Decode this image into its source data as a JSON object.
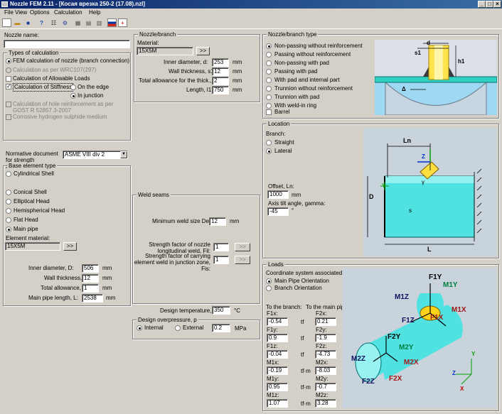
{
  "window": {
    "title": "Nozzle FEM 2.11 - [Косая врезка 250-2 (17.08).nzl]"
  },
  "menu": [
    "File",
    "View",
    "Options",
    "Calculation",
    "Help"
  ],
  "nozzle_name": {
    "label": "Nozzle name:",
    "value": ""
  },
  "calc_types": {
    "legend": "Types of calculation",
    "fem": "FEM calculation of nozzle (branch connection)",
    "wrc": "Calculation as per WRC107(297)",
    "allow": "Calculation of Allowable Loads",
    "stiff": "Calculation of Stiffness",
    "edge": "On the edge",
    "junction": "In junction",
    "hole": "Calculation of hole reinforcement as per GOST R 52857.3-2007",
    "corr": "Corrosive hydrogen sulphide medium"
  },
  "normative": {
    "label": "Normative document for strength estimation:",
    "value": "ASME VIII div 2"
  },
  "base": {
    "legend": "Base element type",
    "cyl": "Cylindrical Shell",
    "con": "Conical Shell",
    "ell": "Elliptical Head",
    "hem": "Hemispherical Head",
    "flat": "Flat Head",
    "main": "Main pipe",
    "mat_label": "Element material:",
    "mat": "15X5M",
    "btn": ">>",
    "D_label": "Inner diameter, D:",
    "D": "506",
    "s_label": "Wall thickness, s:",
    "s": "12",
    "c_label": "Total allowance, c:",
    "c": "1",
    "L_label": "Main pipe length, L:",
    "L": "2538",
    "mm": "mm"
  },
  "branch": {
    "legend": "Nozzle/branch",
    "mat_label": "Material:",
    "mat": "15X5M",
    "btn": ">>",
    "d_label": "Inner diameter, d:",
    "d": "253",
    "s1_label": "Wall thickness, s1:",
    "s1": "12",
    "cs_label": "Total allowance for the thick., cs:",
    "cs": "2",
    "l1_label": "Length, l1:",
    "l1": "750",
    "mm": "mm"
  },
  "weld": {
    "legend": "Weld seams",
    "delta_label": "Minimum weld size Delta:",
    "delta": "12",
    "mm": "mm",
    "fil_label": "Strength factor of nozzle longitudinal weld, Fil:",
    "fil": "1",
    "fis_label": "Strength factor of carrying element weld in junction zone, Fis:",
    "fis": "1",
    "btn": ">>"
  },
  "temp": {
    "label": "Design temperature, T:",
    "value": "350",
    "unit": "°C"
  },
  "pressure": {
    "legend": "Design overpressure, p",
    "internal": "Internal",
    "external": "External",
    "value": "0.2",
    "unit": "MPa"
  },
  "nozzle_type": {
    "legend": "Nozzle/branch type",
    "items": [
      "Non-passing without reinforcement",
      "Passing without reinforcement",
      "Non-passing with pad",
      "Passing with pad",
      "With pad and internal part",
      "Trunnion without reinforcement",
      "Trunnion with pad",
      "With weld-in ring"
    ],
    "barrel": "Barrel",
    "diagram_labels": {
      "d": "d",
      "s1": "s1",
      "h1": "h1",
      "delta": "Δ"
    }
  },
  "location": {
    "legend": "Location",
    "branch_label": "Branch:",
    "straight": "Straight",
    "lateral": "Lateral",
    "offset_label": "Offset, Ln:",
    "offset": "1000",
    "offset_unit": "mm",
    "tilt_label": "Axis tilt angle, gamma:",
    "tilt": "-45",
    "tilt_unit": "°",
    "diagram_labels": {
      "Ln": "Ln",
      "D": "D",
      "L": "L",
      "z": "Z",
      "y": "Y",
      "gamma": "γ",
      "s": "s"
    }
  },
  "loads": {
    "legend": "Loads",
    "cs_label": "Coordinate system associated with:",
    "main": "Main Pipe Orientation",
    "branch": "Branch Orientation",
    "col1": "To the branch:",
    "col2": "To the main pipe:",
    "rows": [
      {
        "n1": "F1x:",
        "v1": "-0.54",
        "u": "tf",
        "n2": "F2x:",
        "v2": "0.21"
      },
      {
        "n1": "F1y:",
        "v1": "0.9",
        "u": "tf",
        "n2": "F2y:",
        "v2": "-1.9"
      },
      {
        "n1": "F1z:",
        "v1": "-0.04",
        "u": "tf",
        "n2": "F2z:",
        "v2": "-4.73"
      },
      {
        "n1": "M1x:",
        "v1": "-0.19",
        "u": "tf·m",
        "n2": "M2x:",
        "v2": "-8.03"
      },
      {
        "n1": "M1y:",
        "v1": "0.95",
        "u": "tf·m",
        "n2": "M2y:",
        "v2": "-0.7"
      },
      {
        "n1": "M1z:",
        "v1": "1.07",
        "u": "tf·m",
        "n2": "M2z:",
        "v2": "3.28"
      }
    ],
    "diagram_labels": {
      "f1y": "F1Y",
      "m1y": "M1Y",
      "m1z": "M1Z",
      "m1x": "M1X",
      "f1z": "F1Z",
      "f1x": "F1X",
      "f2y": "F2Y",
      "m2y": "M2Y",
      "m2z": "M2Z",
      "f2z": "F2Z",
      "f2x": "F2X",
      "m2x": "M2X",
      "axz": "Z",
      "axx": "X",
      "axy": "Y"
    }
  }
}
